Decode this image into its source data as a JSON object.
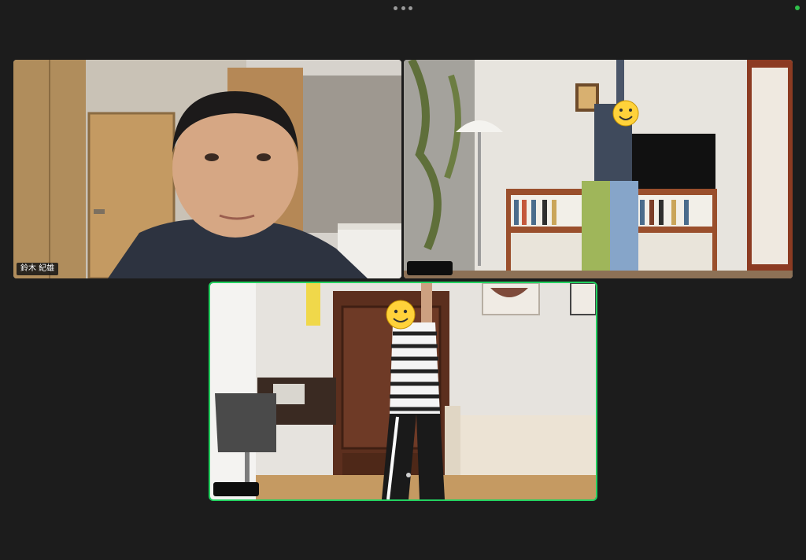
{
  "window": {
    "more_icon": "ellipsis-icon",
    "camera_status_color": "#2fc04a"
  },
  "participants": [
    {
      "name": "鈴木 紀雄",
      "active_speaker": false
    },
    {
      "name": "",
      "active_speaker": false
    },
    {
      "name": "",
      "active_speaker": true
    }
  ],
  "colors": {
    "active_speaker_border": "#23d160",
    "background": "#1c1c1c"
  }
}
